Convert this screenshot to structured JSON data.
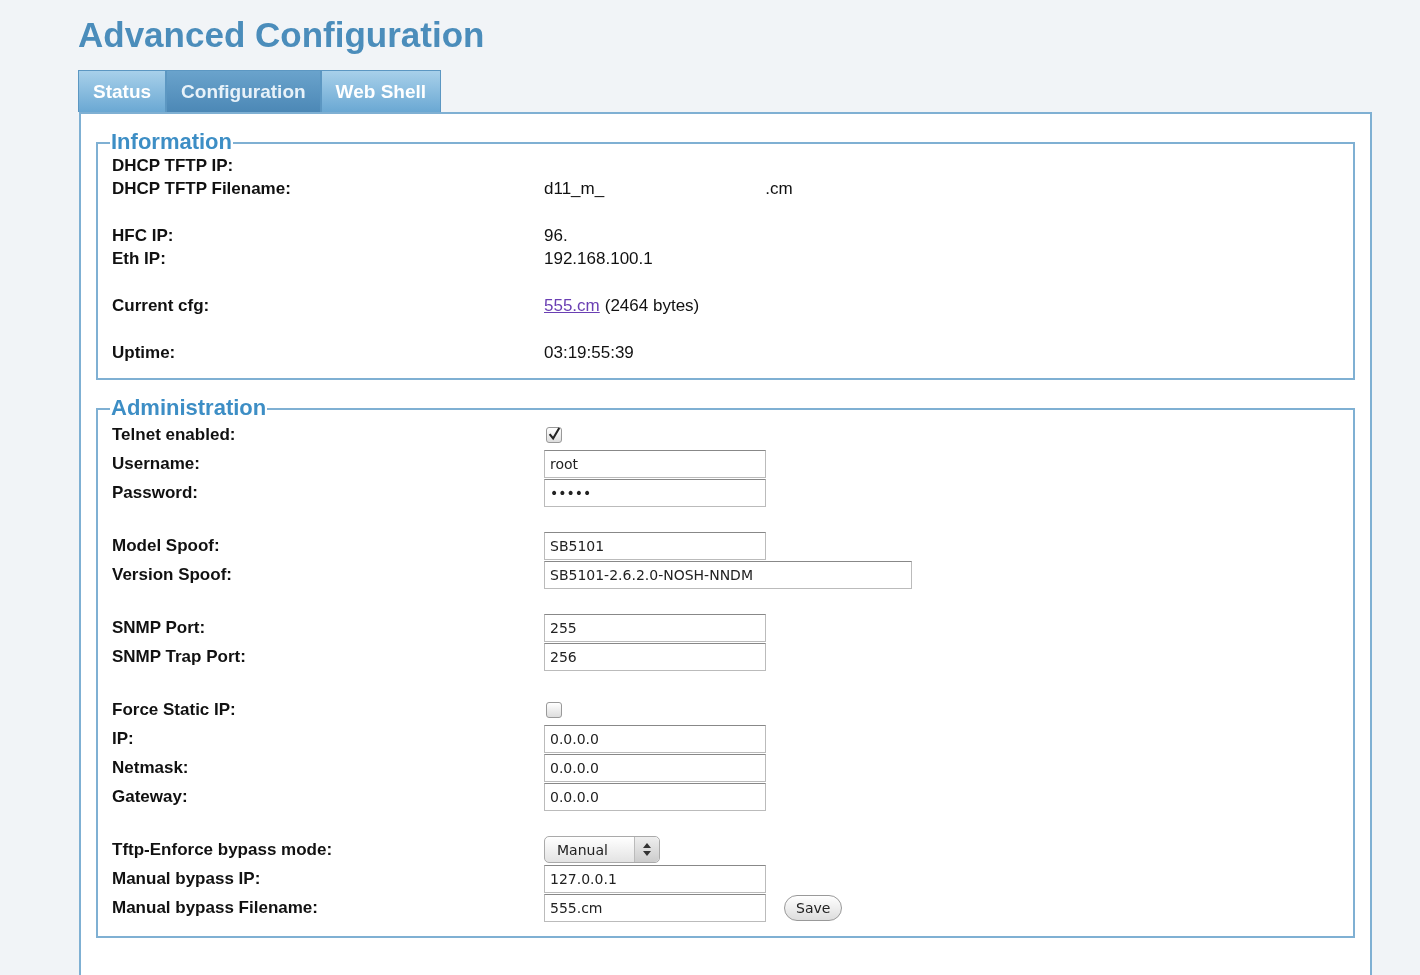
{
  "title": "Advanced Configuration",
  "tabs": [
    {
      "label": "Status",
      "selected": false
    },
    {
      "label": "Configuration",
      "selected": true
    },
    {
      "label": "Web Shell",
      "selected": false
    }
  ],
  "information": {
    "legend": "Information",
    "groups": [
      [
        {
          "label": "DHCP TFTP IP:"
        },
        {
          "label": "DHCP TFTP Filename:",
          "parts": [
            "d11_m_",
            ".cm"
          ]
        }
      ],
      [
        {
          "label": "HFC IP:",
          "value": "96."
        },
        {
          "label": "Eth IP:",
          "value": "192.168.100.1"
        }
      ],
      [
        {
          "label": "Current cfg:",
          "link": "555.cm",
          "value": "(2464 bytes)"
        }
      ],
      [
        {
          "label": "Uptime:",
          "value": "03:19:55:39"
        }
      ]
    ]
  },
  "administration": {
    "legend": "Administration",
    "groups": [
      [
        {
          "kind": "checkbox",
          "label": "Telnet enabled:",
          "checked": true
        },
        {
          "kind": "text",
          "label": "Username:",
          "value": "root"
        },
        {
          "kind": "password",
          "label": "Password:",
          "value": "•••••"
        }
      ],
      [
        {
          "kind": "text",
          "label": "Model Spoof:",
          "value": "SB5101"
        },
        {
          "kind": "text",
          "label": "Version Spoof:",
          "value": "SB5101-2.6.2.0-NOSH-NNDM"
        }
      ],
      [
        {
          "kind": "text",
          "label": "SNMP Port:",
          "value": "255"
        },
        {
          "kind": "text",
          "label": "SNMP Trap Port:",
          "value": "256"
        }
      ],
      [
        {
          "kind": "checkbox",
          "label": "Force Static IP:",
          "checked": false
        },
        {
          "kind": "text",
          "label": "IP:",
          "value": "0.0.0.0"
        },
        {
          "kind": "text",
          "label": "Netmask:",
          "value": "0.0.0.0"
        },
        {
          "kind": "text",
          "label": "Gateway:",
          "value": "0.0.0.0"
        }
      ],
      [
        {
          "kind": "select",
          "label": "Tftp-Enforce bypass mode:",
          "value": "Manual"
        },
        {
          "kind": "text",
          "label": "Manual bypass IP:",
          "value": "127.0.0.1"
        },
        {
          "kind": "text",
          "label": "Manual bypass Filename:",
          "value": "555.cm",
          "button": "Save"
        }
      ]
    ]
  }
}
